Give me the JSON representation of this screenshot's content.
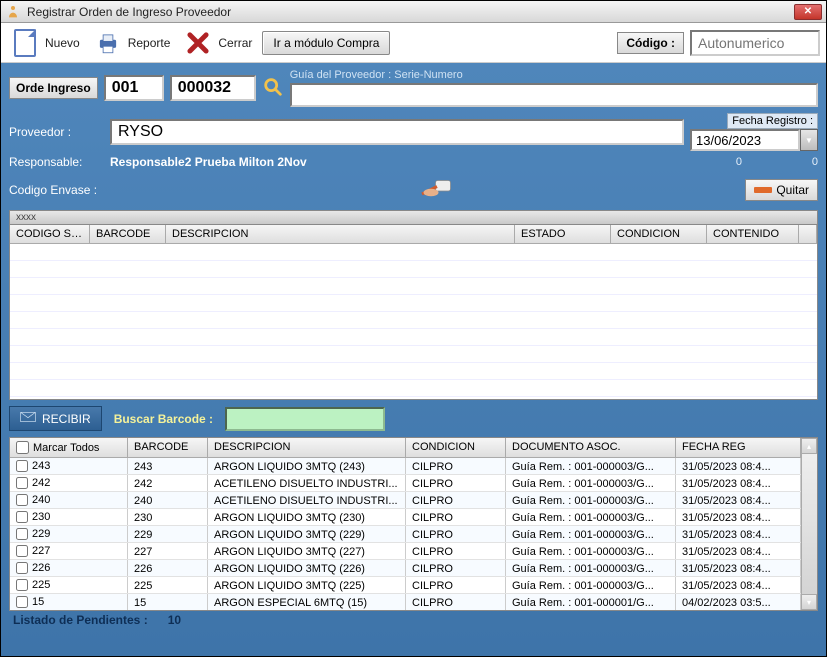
{
  "window": {
    "title": "Registrar Orden de Ingreso Proveedor"
  },
  "toolbar": {
    "nuevo": "Nuevo",
    "reporte": "Reporte",
    "cerrar": "Cerrar",
    "ira_modulo": "Ir a módulo Compra",
    "codigo_label": "Código :",
    "codigo_placeholder": "Autonumerico"
  },
  "orden": {
    "label": "Orde Ingreso",
    "serie": "001",
    "numero": "000032",
    "guia_label": "Guía del Proveedor : Serie-Numero",
    "guia_value": "",
    "fecha_label": "Fecha Registro :",
    "fecha_value": "13/06/2023"
  },
  "proveedor": {
    "label": "Proveedor :",
    "value": "RYSO"
  },
  "responsable": {
    "label": "Responsable:",
    "value": "Responsable2 Prueba Milton 2Nov"
  },
  "zeros": {
    "a": "0",
    "b": "0"
  },
  "envase": {
    "label": "Codigo Envase :"
  },
  "quitar": {
    "label": "Quitar"
  },
  "tab": {
    "label": "xxxx"
  },
  "upper_headers": {
    "sap": "CODIGO SAP",
    "barcode": "BARCODE",
    "desc": "DESCRIPCION",
    "estado": "ESTADO",
    "cond": "CONDICION",
    "cont": "CONTENIDO"
  },
  "recibir": {
    "label": "RECIBIR"
  },
  "buscar": {
    "label": "Buscar Barcode :"
  },
  "lower_headers": {
    "marcar": "Marcar Todos",
    "barcode": "BARCODE",
    "desc": "DESCRIPCION",
    "cond": "CONDICION",
    "doc": "DOCUMENTO ASOC.",
    "fecha": "FECHA REG"
  },
  "rows": [
    {
      "id": "243",
      "barcode": "243",
      "desc": "ARGON LIQUIDO 3MTQ (243)",
      "cond": "CILPRO",
      "doc": "Guía Rem. : 001-000003/G...",
      "fecha": "31/05/2023 08:4..."
    },
    {
      "id": "242",
      "barcode": "242",
      "desc": "ACETILENO DISUELTO INDUSTRI...",
      "cond": "CILPRO",
      "doc": "Guía Rem. : 001-000003/G...",
      "fecha": "31/05/2023 08:4..."
    },
    {
      "id": "240",
      "barcode": "240",
      "desc": "ACETILENO DISUELTO INDUSTRI...",
      "cond": "CILPRO",
      "doc": "Guía Rem. : 001-000003/G...",
      "fecha": "31/05/2023 08:4..."
    },
    {
      "id": "230",
      "barcode": "230",
      "desc": "ARGON LIQUIDO 3MTQ (230)",
      "cond": "CILPRO",
      "doc": "Guía Rem. : 001-000003/G...",
      "fecha": "31/05/2023 08:4..."
    },
    {
      "id": "229",
      "barcode": "229",
      "desc": "ARGON LIQUIDO 3MTQ (229)",
      "cond": "CILPRO",
      "doc": "Guía Rem. : 001-000003/G...",
      "fecha": "31/05/2023 08:4..."
    },
    {
      "id": "227",
      "barcode": "227",
      "desc": "ARGON LIQUIDO 3MTQ (227)",
      "cond": "CILPRO",
      "doc": "Guía Rem. : 001-000003/G...",
      "fecha": "31/05/2023 08:4..."
    },
    {
      "id": "226",
      "barcode": "226",
      "desc": "ARGON LIQUIDO 3MTQ (226)",
      "cond": "CILPRO",
      "doc": "Guía Rem. : 001-000003/G...",
      "fecha": "31/05/2023 08:4..."
    },
    {
      "id": "225",
      "barcode": "225",
      "desc": "ARGON LIQUIDO 3MTQ (225)",
      "cond": "CILPRO",
      "doc": "Guía Rem. : 001-000003/G...",
      "fecha": "31/05/2023 08:4..."
    },
    {
      "id": "15",
      "barcode": "15",
      "desc": "ARGON ESPECIAL 6MTQ (15)",
      "cond": "CILPRO",
      "doc": "Guía Rem. : 001-000001/G...",
      "fecha": "04/02/2023 03:5..."
    }
  ],
  "footer": {
    "label": "Listado de Pendientes :",
    "count": "10"
  }
}
